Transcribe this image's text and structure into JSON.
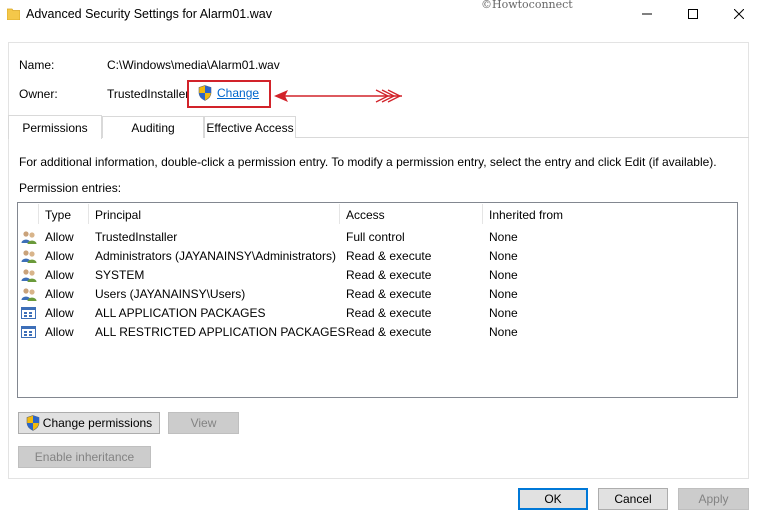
{
  "window": {
    "title": "Advanced Security Settings for Alarm01.wav",
    "watermark": "©Howtoconnect",
    "controls": [
      "minimize",
      "maximize",
      "close"
    ]
  },
  "info": {
    "name_label": "Name:",
    "name_value": "C:\\Windows\\media\\Alarm01.wav",
    "owner_label": "Owner:",
    "owner_value": "TrustedInstaller",
    "change_link": "Change",
    "annotation_color": "#d2232a"
  },
  "tabs": [
    {
      "label": "Permissions",
      "active": true
    },
    {
      "label": "Auditing",
      "active": false
    },
    {
      "label": "Effective Access",
      "active": false
    }
  ],
  "instructions": "For additional information, double-click a permission entry. To modify a permission entry, select the entry and click Edit (if available).",
  "entries_label": "Permission entries:",
  "table": {
    "columns": [
      "Type",
      "Principal",
      "Access",
      "Inherited from"
    ],
    "rows": [
      {
        "icon": "users-icon",
        "type": "Allow",
        "principal": "TrustedInstaller",
        "access": "Full control",
        "inherited": "None"
      },
      {
        "icon": "users-icon",
        "type": "Allow",
        "principal": "Administrators (JAYANAINSY\\Administrators)",
        "access": "Read & execute",
        "inherited": "None"
      },
      {
        "icon": "users-icon",
        "type": "Allow",
        "principal": "SYSTEM",
        "access": "Read & execute",
        "inherited": "None"
      },
      {
        "icon": "users-icon",
        "type": "Allow",
        "principal": "Users (JAYANAINSY\\Users)",
        "access": "Read & execute",
        "inherited": "None"
      },
      {
        "icon": "app-package-icon",
        "type": "Allow",
        "principal": "ALL APPLICATION PACKAGES",
        "access": "Read & execute",
        "inherited": "None"
      },
      {
        "icon": "app-package-icon",
        "type": "Allow",
        "principal": "ALL RESTRICTED APPLICATION PACKAGES",
        "access": "Read & execute",
        "inherited": "None"
      }
    ]
  },
  "buttons": {
    "change_permissions": "Change permissions",
    "view": "View",
    "enable_inheritance": "Enable inheritance",
    "ok": "OK",
    "cancel": "Cancel",
    "apply": "Apply"
  }
}
